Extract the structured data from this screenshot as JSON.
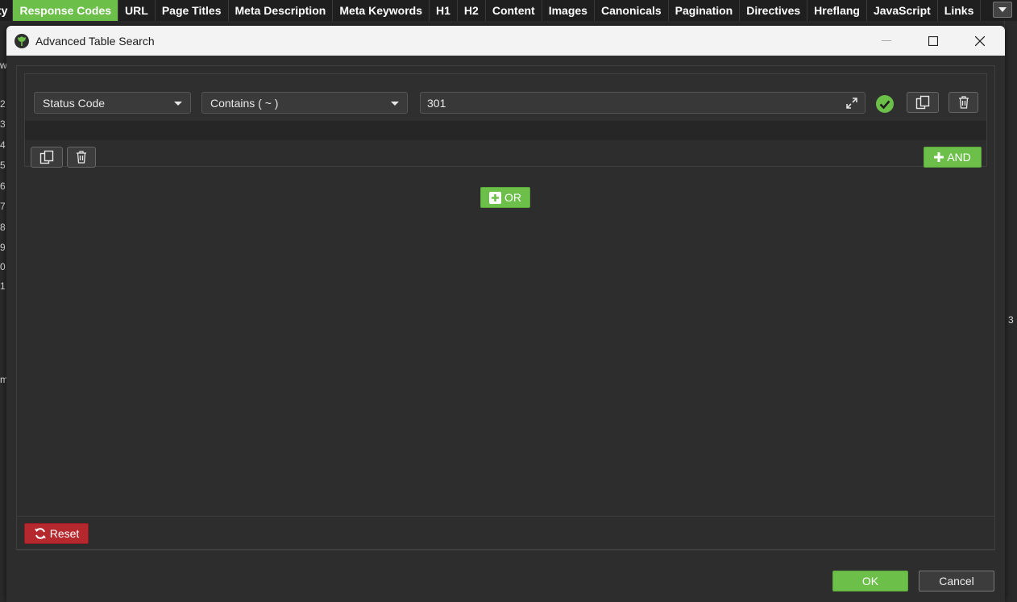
{
  "tabs": [
    {
      "label": "ty",
      "active": false
    },
    {
      "label": "Response Codes",
      "active": true
    },
    {
      "label": "URL",
      "active": false
    },
    {
      "label": "Page Titles",
      "active": false
    },
    {
      "label": "Meta Description",
      "active": false
    },
    {
      "label": "Meta Keywords",
      "active": false
    },
    {
      "label": "H1",
      "active": false
    },
    {
      "label": "H2",
      "active": false
    },
    {
      "label": "Content",
      "active": false
    },
    {
      "label": "Images",
      "active": false
    },
    {
      "label": "Canonicals",
      "active": false
    },
    {
      "label": "Pagination",
      "active": false
    },
    {
      "label": "Directives",
      "active": false
    },
    {
      "label": "Hreflang",
      "active": false
    },
    {
      "label": "JavaScript",
      "active": false
    },
    {
      "label": "Links",
      "active": false
    }
  ],
  "background": {
    "left_digits": [
      "w",
      "2",
      "3",
      "4",
      "5",
      "6",
      "7",
      "8",
      "9",
      "0",
      "1",
      "m"
    ],
    "right_digit": "3"
  },
  "dialog": {
    "title": "Advanced Table Search",
    "condition": {
      "field": "Status Code",
      "operator": "Contains ( ~ )",
      "value": "301"
    },
    "and_label": "AND",
    "or_label": "OR",
    "reset_label": "Reset",
    "ok_label": "OK",
    "cancel_label": "Cancel"
  },
  "colors": {
    "accent_green": "#6cc04a",
    "reset_red": "#b5282d",
    "valid_check": "#6cc04a"
  }
}
